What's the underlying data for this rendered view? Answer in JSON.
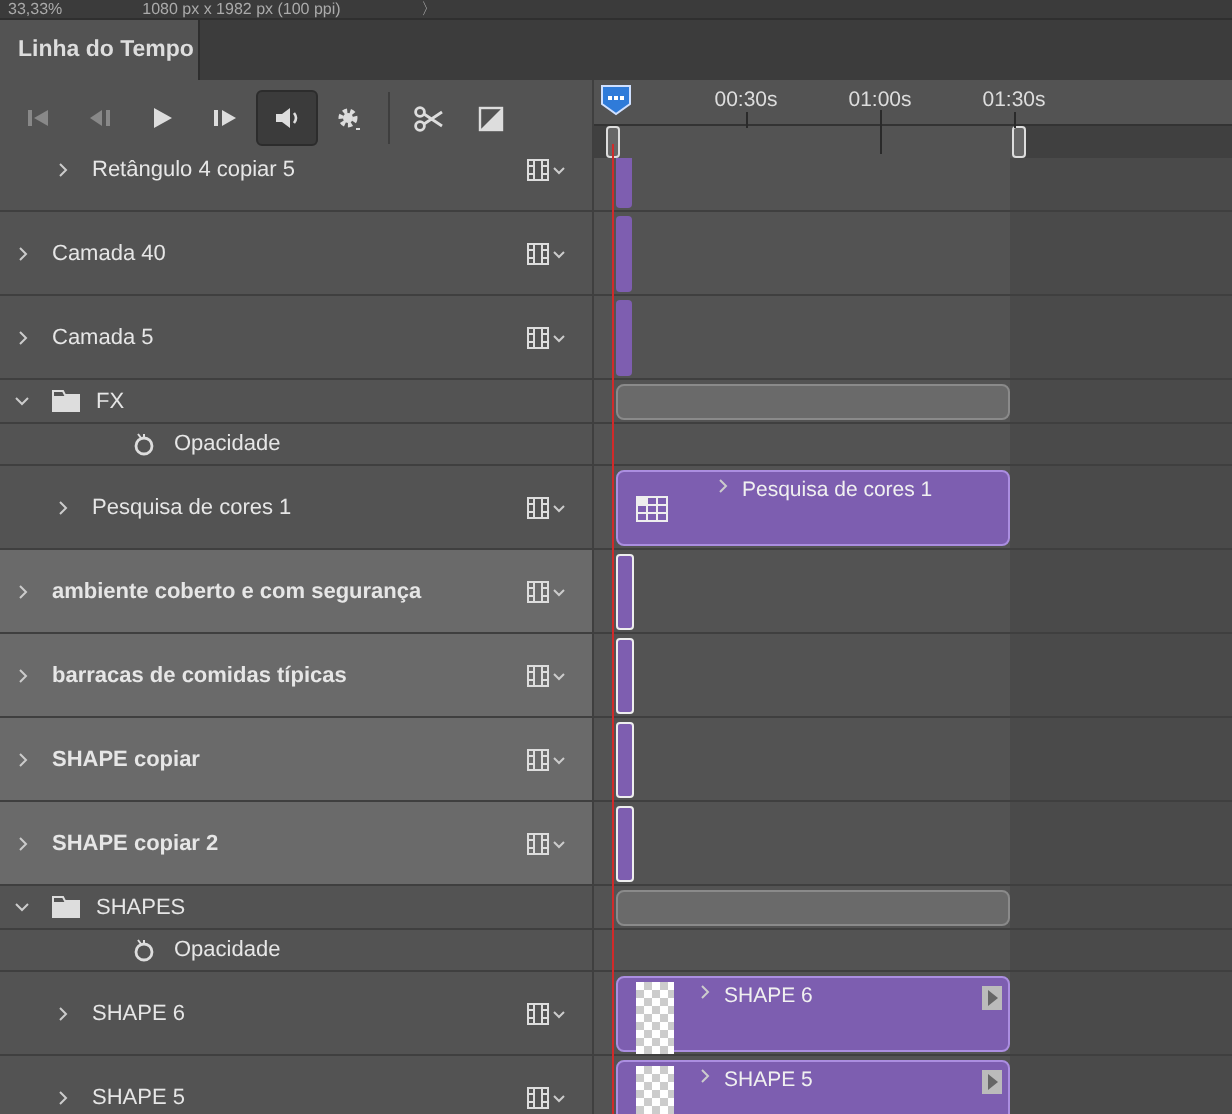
{
  "doc_bar": {
    "zoom": "33,33%",
    "size": "1080 px x 1982 px (100 ppi)",
    "arrow": "〉"
  },
  "panel_tab": {
    "label": "Linha do Tempo",
    "selected": true
  },
  "toolbar": [
    {
      "kind": "first",
      "on": false
    },
    {
      "kind": "prev",
      "on": false
    },
    {
      "kind": "play",
      "on": false
    },
    {
      "kind": "next",
      "on": false
    },
    {
      "kind": "audio",
      "on": true
    },
    {
      "kind": "settings",
      "on": false
    },
    {
      "kind": "cut",
      "on": false
    },
    {
      "kind": "transition",
      "on": false
    }
  ],
  "ruler": {
    "labels": [
      "00:30s",
      "01:00s",
      "01:30s"
    ]
  },
  "layers": [
    {
      "kind": "group-tail",
      "children": [
        {
          "kind": "layer",
          "name": "Retângulo 4 copiar 5",
          "selected": false,
          "expanded": false,
          "clip": {
            "kind": "thin"
          }
        }
      ]
    },
    {
      "kind": "layer",
      "name": "Camada 40",
      "selected": false,
      "expanded": false,
      "clip": {
        "kind": "thin"
      }
    },
    {
      "kind": "layer",
      "name": "Camada 5",
      "selected": false,
      "expanded": false,
      "clip": {
        "kind": "thin"
      }
    },
    {
      "kind": "group",
      "name": "FX",
      "expanded": true,
      "properties": [
        "Opacidade"
      ],
      "children": [
        {
          "kind": "layer",
          "name": "Pesquisa de cores 1",
          "selected": false,
          "expanded": false,
          "clip": {
            "kind": "adjustment",
            "label": "Pesquisa de cores 1"
          }
        }
      ]
    },
    {
      "kind": "layer",
      "name": "ambiente coberto e com segurança",
      "selected": true,
      "expanded": false,
      "clip": {
        "kind": "thin"
      }
    },
    {
      "kind": "layer",
      "name": "barracas de comidas típicas",
      "selected": true,
      "expanded": false,
      "clip": {
        "kind": "thin"
      }
    },
    {
      "kind": "layer",
      "name": "SHAPE copiar",
      "selected": true,
      "expanded": false,
      "clip": {
        "kind": "thin"
      }
    },
    {
      "kind": "layer",
      "name": "SHAPE copiar 2",
      "selected": true,
      "expanded": false,
      "clip": {
        "kind": "thin"
      }
    },
    {
      "kind": "group",
      "name": "SHAPES",
      "expanded": true,
      "properties": [
        "Opacidade"
      ],
      "children": [
        {
          "kind": "layer",
          "name": "SHAPE  6",
          "selected": false,
          "expanded": false,
          "clip": {
            "kind": "video",
            "label": "SHAPE  6"
          }
        },
        {
          "kind": "layer",
          "name": "SHAPE  5",
          "selected": false,
          "expanded": false,
          "clip": {
            "kind": "video",
            "label": "SHAPE  5"
          }
        }
      ]
    }
  ]
}
